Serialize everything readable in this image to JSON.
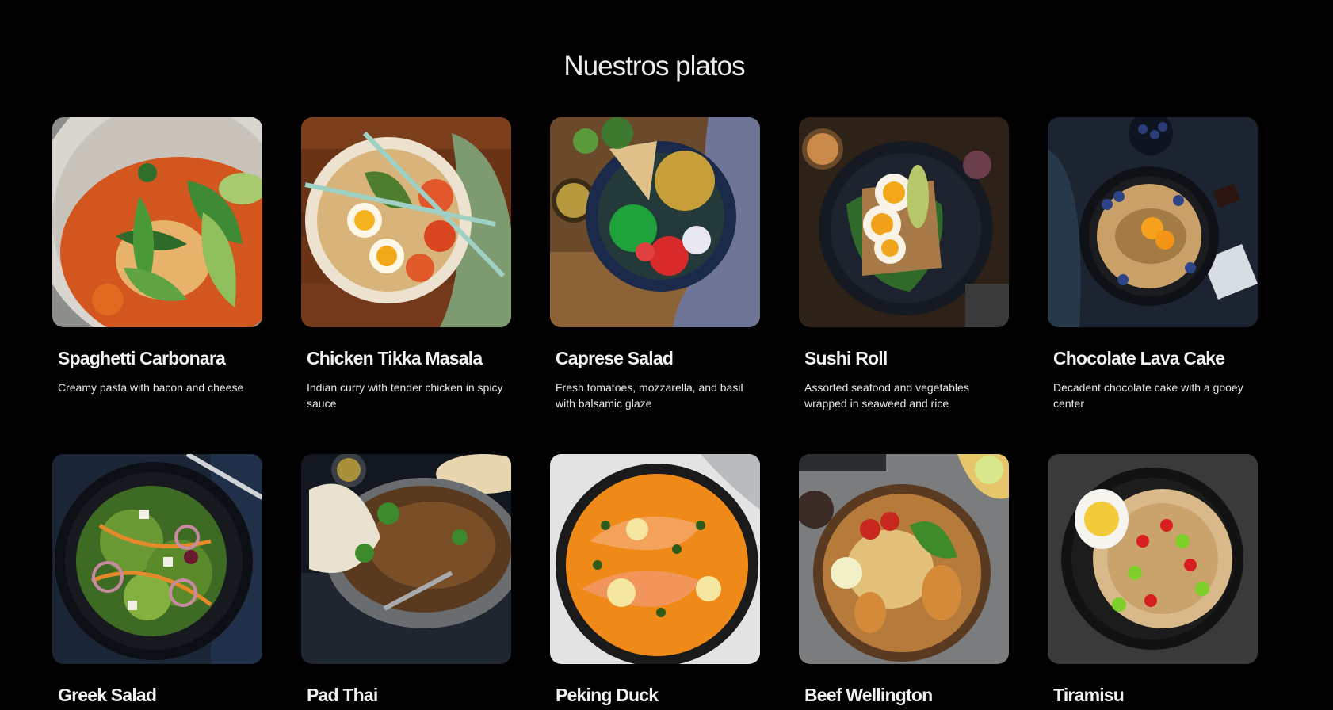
{
  "section": {
    "title": "Nuestros platos"
  },
  "dishes": [
    {
      "name": "Spaghetti Carbonara",
      "description": "Creamy pasta with bacon and cheese",
      "image": "spaghetti-carbonara-photo"
    },
    {
      "name": "Chicken Tikka Masala",
      "description": "Indian curry with tender chicken in spicy sauce",
      "image": "chicken-tikka-masala-photo"
    },
    {
      "name": "Caprese Salad",
      "description": "Fresh tomatoes, mozzarella, and basil with balsamic glaze",
      "image": "caprese-salad-photo"
    },
    {
      "name": "Sushi Roll",
      "description": "Assorted seafood and vegetables wrapped in seaweed and rice",
      "image": "sushi-roll-photo"
    },
    {
      "name": "Chocolate Lava Cake",
      "description": "Decadent chocolate cake with a gooey center",
      "image": "chocolate-lava-cake-photo"
    },
    {
      "name": "Greek Salad",
      "description": "",
      "image": "greek-salad-photo"
    },
    {
      "name": "Pad Thai",
      "description": "",
      "image": "pad-thai-photo"
    },
    {
      "name": "Peking Duck",
      "description": "",
      "image": "peking-duck-photo"
    },
    {
      "name": "Beef Wellington",
      "description": "",
      "image": "beef-wellington-photo"
    },
    {
      "name": "Tiramisu",
      "description": "",
      "image": "tiramisu-photo"
    }
  ],
  "colors": {
    "background": "#000000",
    "title_text": "#ececec",
    "card_title_text": "#f2f2f2",
    "card_desc_text": "#e6e6e6"
  }
}
